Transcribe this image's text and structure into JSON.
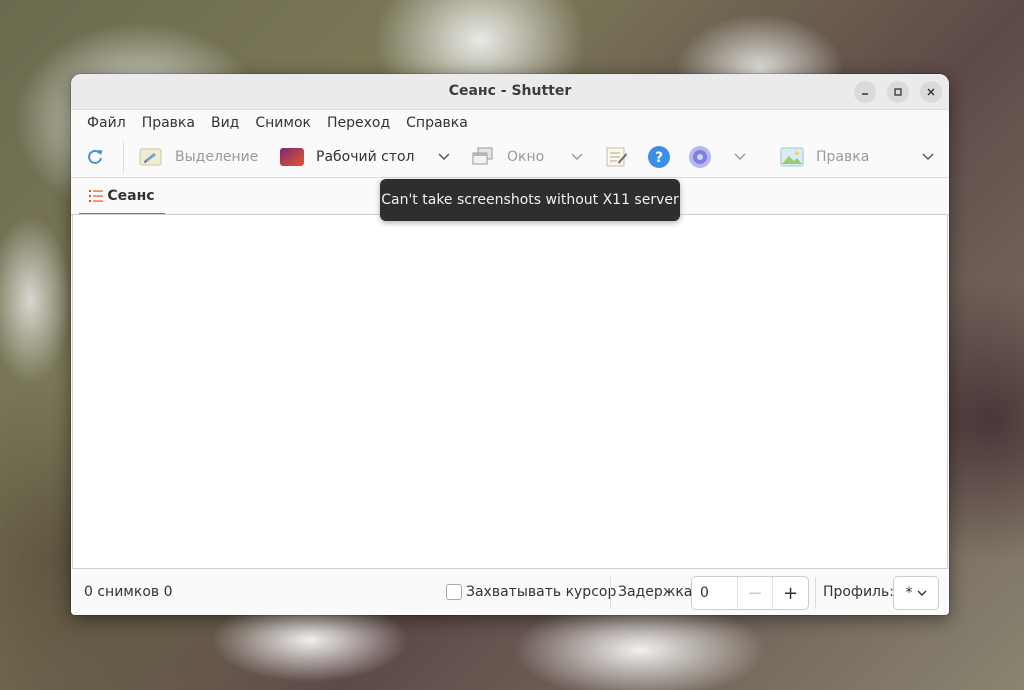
{
  "window": {
    "title": "Сеанс - Shutter"
  },
  "menubar": {
    "items": [
      "Файл",
      "Правка",
      "Вид",
      "Снимок",
      "Переход",
      "Справка"
    ]
  },
  "toolbar": {
    "refresh_icon": "refresh-icon",
    "selection_label": "Выделение",
    "desktop_label": "Рабочий стол",
    "window_label": "Окно",
    "edit_label": "Правка"
  },
  "tabs": [
    {
      "label": "Сеанс",
      "icon": "list-icon",
      "active": true
    }
  ],
  "tooltip": {
    "text": "Can't take screenshots without X11 server"
  },
  "statusbar": {
    "count_text": "0 снимков  0",
    "capture_cursor_label": "Захватывать курсор",
    "capture_cursor_checked": false,
    "delay_label": "Задержка:",
    "delay_value": "0",
    "delay_minus": "−",
    "delay_plus": "+",
    "profile_label": "Профиль:",
    "profile_value": "*"
  },
  "colors": {
    "accent": "#e95420",
    "tooltip_bg": "#2e2e2e",
    "help_blue": "#3c8ee6"
  }
}
